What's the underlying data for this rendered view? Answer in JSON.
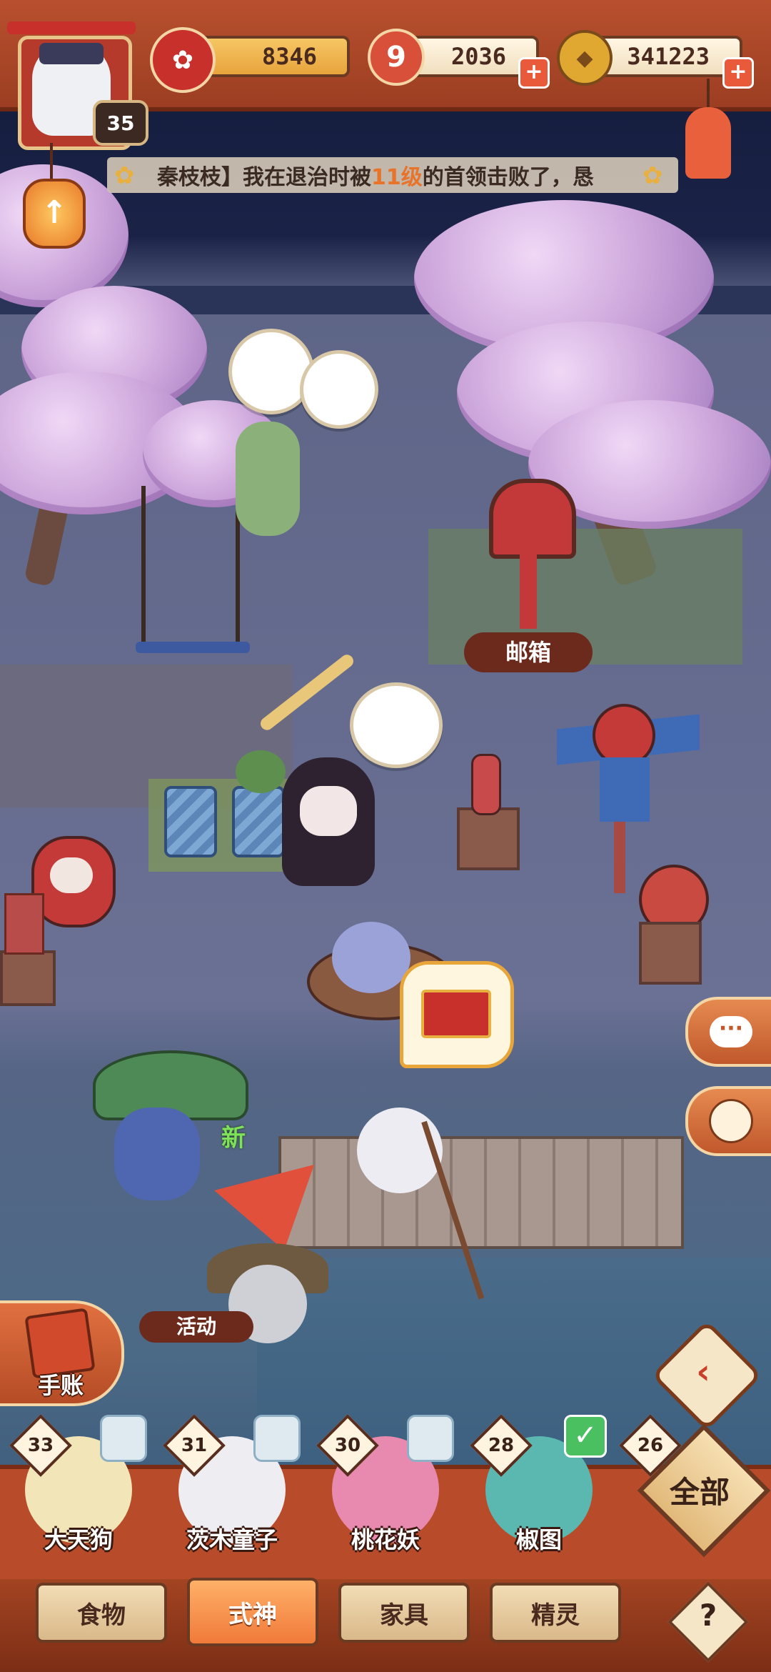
{
  "player": {
    "level": "35"
  },
  "resources": {
    "blossom": "8346",
    "tickets": "2036",
    "coins": "341223"
  },
  "ticker": {
    "prefix": "秦枝枝】我在退治时被",
    "highlight": "11级",
    "suffix": "的首领击败了，恳"
  },
  "map_labels": {
    "mailbox": "邮箱",
    "new": "新",
    "partial_sign": "活动"
  },
  "notebook_label": "手账",
  "shikigami": [
    {
      "name": "大天狗",
      "level": "33",
      "selected": false
    },
    {
      "name": "茨木童子",
      "level": "31",
      "selected": false
    },
    {
      "name": "桃花妖",
      "level": "30",
      "selected": false
    },
    {
      "name": "椒图",
      "level": "28",
      "selected": true
    },
    {
      "name": "",
      "level": "26",
      "selected": false
    }
  ],
  "all_button": "全部",
  "tabs": [
    {
      "label": "食物",
      "active": false
    },
    {
      "label": "式神",
      "active": true
    },
    {
      "label": "家具",
      "active": false
    },
    {
      "label": "精灵",
      "active": false
    }
  ],
  "help": "?",
  "colors": {
    "frame": "#b84c2a",
    "accent_orange": "#f07a3a",
    "pill_bg": "#f1dfbe",
    "night_sky": "#131a3a"
  }
}
